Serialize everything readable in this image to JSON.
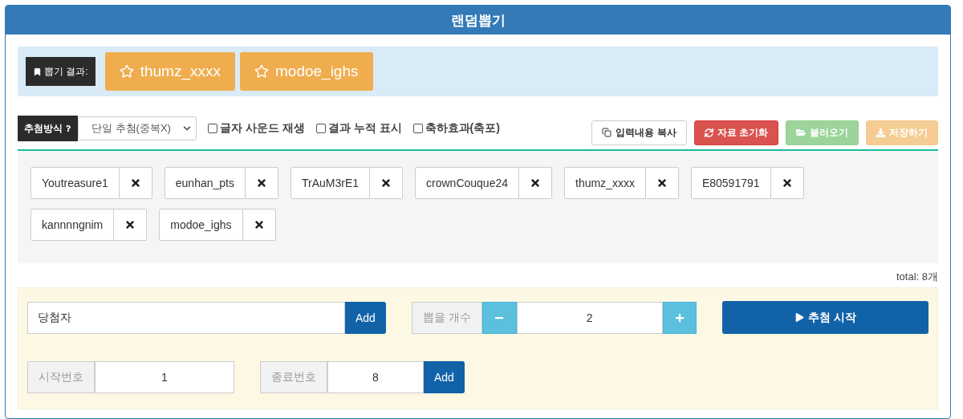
{
  "title": "랜덤뽑기",
  "result": {
    "label": "뽑기 결과:",
    "winners": [
      "thumz_xxxx",
      "modoe_ighs"
    ]
  },
  "method": {
    "label": "추첨방식",
    "selected_option": "단일 추첨(중복X)"
  },
  "options": [
    {
      "label": "글자 사운드 재생",
      "checked": false
    },
    {
      "label": "결과 누적 표시",
      "checked": false
    },
    {
      "label": "축하효과(축포)",
      "checked": false
    }
  ],
  "actions": [
    {
      "kind": "copy",
      "label": "입력내용 복사",
      "disabled": false
    },
    {
      "kind": "reset",
      "label": "자료 초기화",
      "disabled": false
    },
    {
      "kind": "load",
      "label": "불러오기",
      "disabled": true
    },
    {
      "kind": "save",
      "label": "저장하기",
      "disabled": true
    }
  ],
  "entries": [
    "Youtreasure1",
    "eunhan_pts",
    "TrAuM3rE1",
    "crownCouque24",
    "thumz_xxxx",
    "E80591791",
    "kannnngnim",
    "modoe_ighs"
  ],
  "total": "total: 8개",
  "name_input": {
    "value": "당첨자",
    "button": "Add"
  },
  "count": {
    "label": "뽑을 개수",
    "value": "2"
  },
  "start_button": "추첨 시작",
  "range": {
    "start_label": "시작번호",
    "start_value": "1",
    "end_label": "종료번호",
    "end_value": "8",
    "button": "Add"
  }
}
